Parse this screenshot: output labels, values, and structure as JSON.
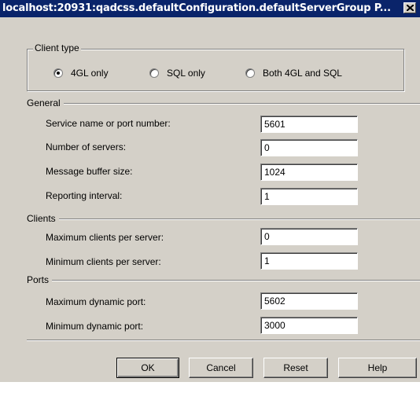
{
  "window": {
    "title": "localhost:20931:qadcss.defaultConfiguration.defaultServerGroup P..."
  },
  "client_type": {
    "caption": "Client type",
    "options": [
      {
        "label": "4GL only",
        "selected": true
      },
      {
        "label": "SQL only",
        "selected": false
      },
      {
        "label": "Both 4GL and SQL",
        "selected": false
      }
    ]
  },
  "general": {
    "label": "General",
    "fields": [
      {
        "label": "Service name or port number:",
        "value": "5601"
      },
      {
        "label": "Number of servers:",
        "value": "0"
      },
      {
        "label": "Message buffer size:",
        "value": "1024"
      },
      {
        "label": "Reporting interval:",
        "value": "1"
      }
    ]
  },
  "clients": {
    "label": "Clients",
    "fields": [
      {
        "label": "Maximum clients per server:",
        "value": "0"
      },
      {
        "label": "Minimum clients per server:",
        "value": "1"
      }
    ]
  },
  "ports": {
    "label": "Ports",
    "fields": [
      {
        "label": "Maximum dynamic port:",
        "value": "5602"
      },
      {
        "label": "Minimum dynamic port:",
        "value": "3000"
      }
    ]
  },
  "buttons": {
    "ok": "OK",
    "cancel": "Cancel",
    "reset": "Reset",
    "help": "Help"
  },
  "colors": {
    "title_bar": "#0a246a",
    "dialog_face": "#d4d0c8"
  }
}
